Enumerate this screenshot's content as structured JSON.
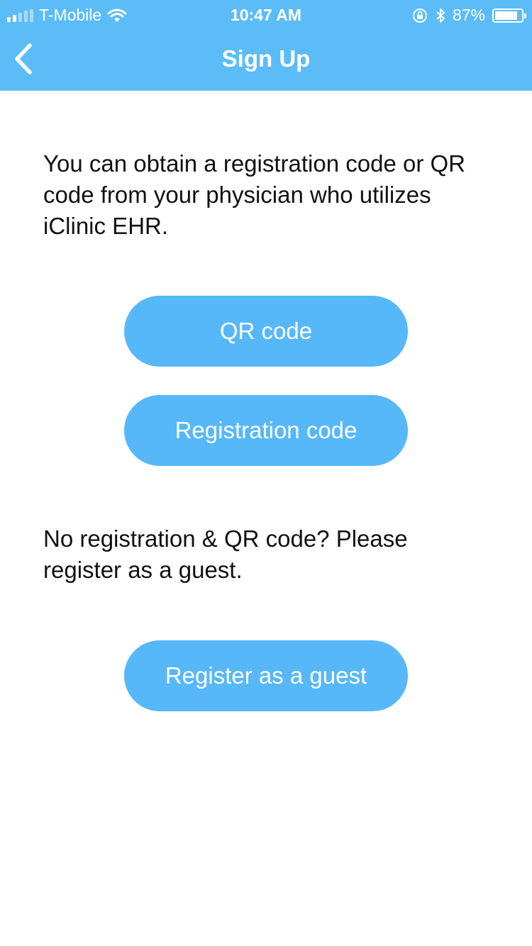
{
  "status_bar": {
    "carrier": "T-Mobile",
    "time": "10:47 AM",
    "battery_percent": "87%",
    "battery_level": 0.87,
    "icons": [
      "signal-icon",
      "wifi-icon",
      "orientation-lock-icon",
      "bluetooth-icon",
      "battery-icon"
    ]
  },
  "nav": {
    "title": "Sign Up",
    "back_icon": "chevron-left-icon"
  },
  "main": {
    "intro_text": "You can obtain a registration code or QR code from your physician who utilizes iClinic EHR.",
    "qr_button": "QR code",
    "registration_button": "Registration code",
    "guest_text": "No registration & QR code? Please register as a guest.",
    "guest_button": "Register as a guest"
  },
  "colors": {
    "header": "#5bbcf8",
    "button": "#56b8f9",
    "text": "#111111",
    "background": "#ffffff"
  }
}
